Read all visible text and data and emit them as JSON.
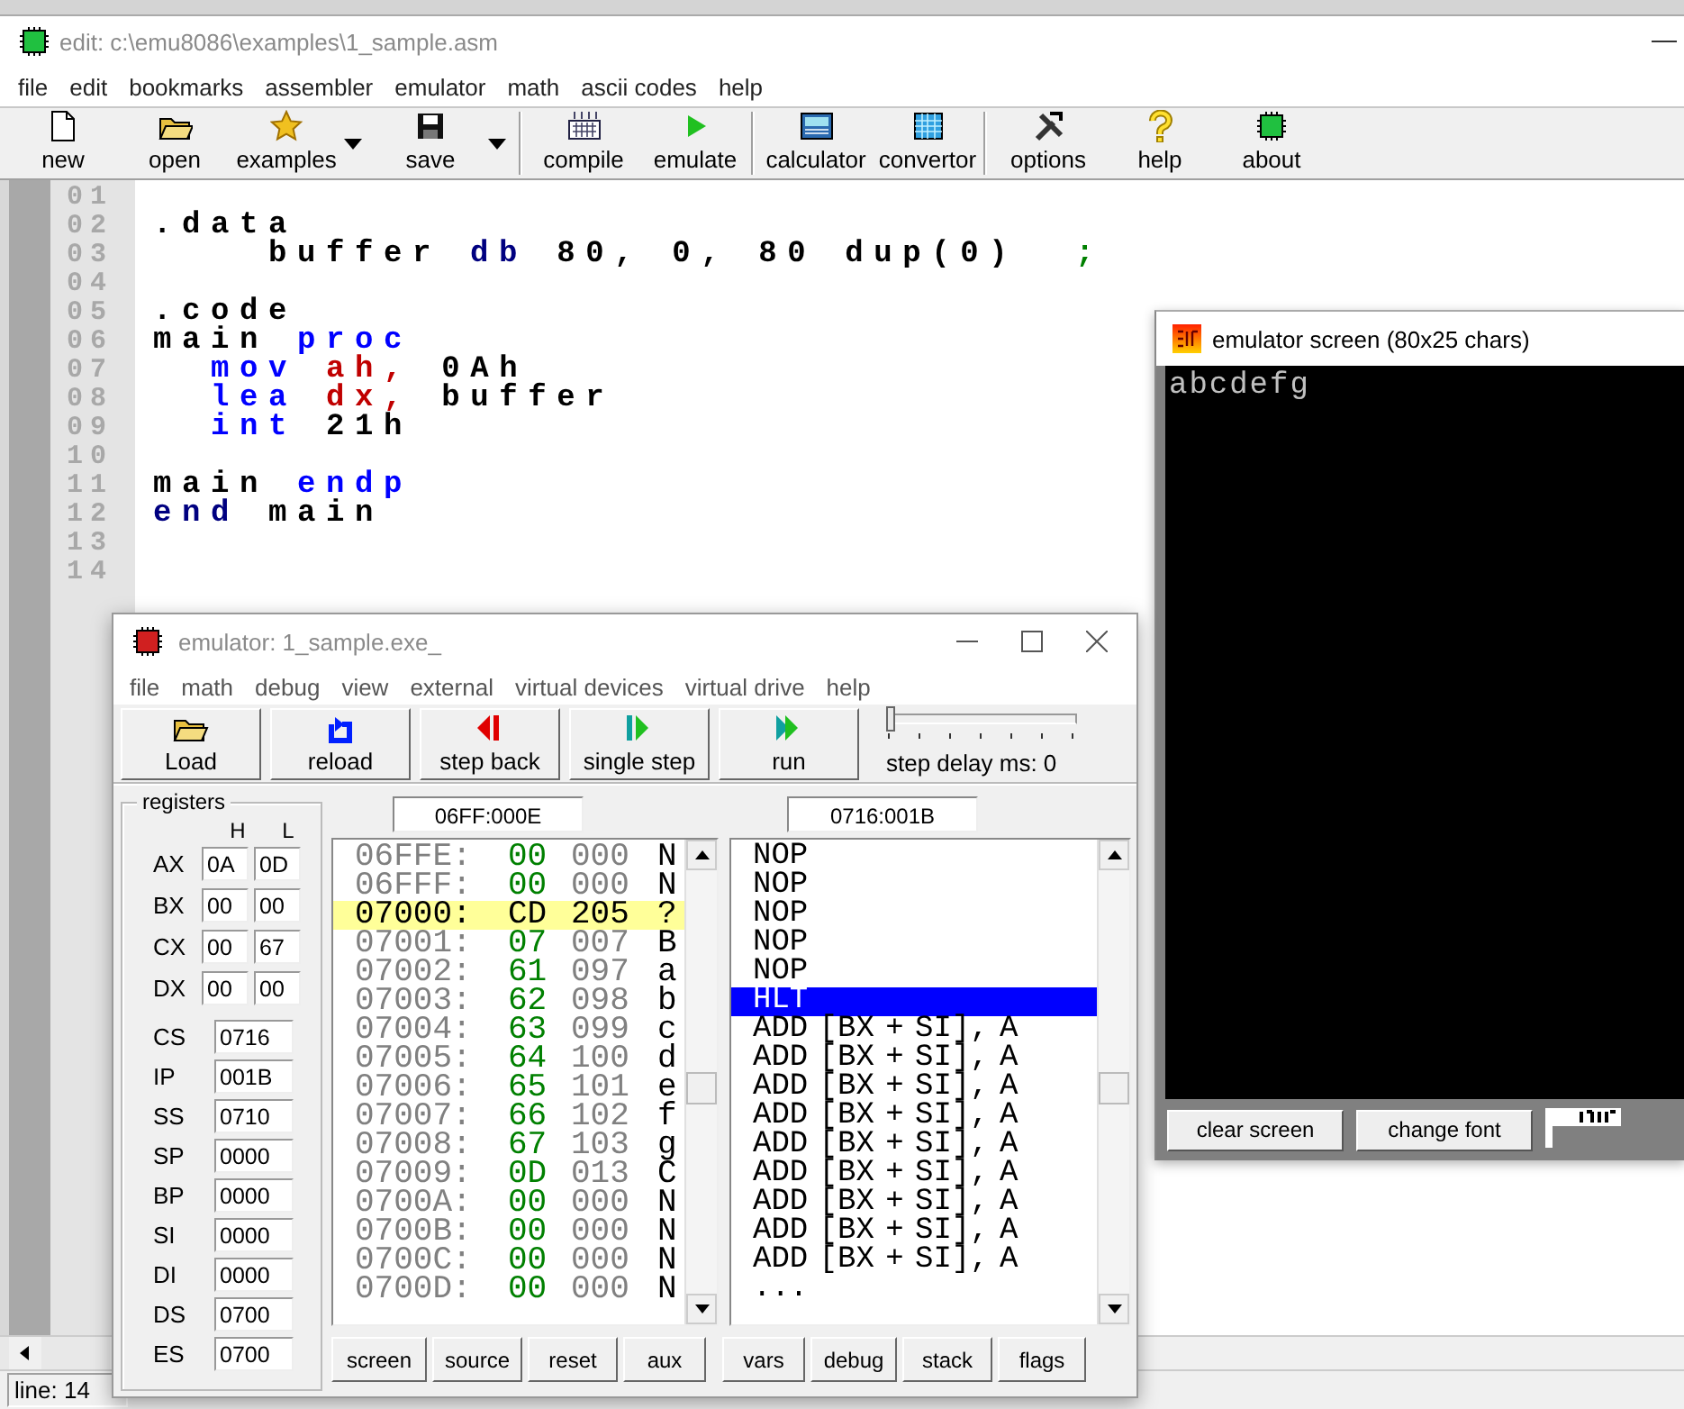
{
  "editor": {
    "title": "edit: c:\\emu8086\\examples\\1_sample.asm",
    "menu": [
      "file",
      "edit",
      "bookmarks",
      "assembler",
      "emulator",
      "math",
      "ascii codes",
      "help"
    ],
    "toolbar_groups": [
      [
        {
          "label": "new",
          "kind": "button"
        },
        {
          "label": "open",
          "kind": "button"
        },
        {
          "label": "examples",
          "kind": "dropdown"
        },
        {
          "label": "save",
          "kind": "dropdown"
        }
      ],
      [
        {
          "label": "compile",
          "kind": "button"
        },
        {
          "label": "emulate",
          "kind": "button"
        }
      ],
      [
        {
          "label": "calculator",
          "kind": "button"
        },
        {
          "label": "convertor",
          "kind": "button"
        }
      ],
      [
        {
          "label": "options",
          "kind": "button"
        },
        {
          "label": "help",
          "kind": "button"
        },
        {
          "label": "about",
          "kind": "button"
        }
      ]
    ],
    "code_lines": [
      {
        "number": "01"
      },
      {
        "number": "02",
        "kind": "top",
        "tokens": [
          {
            "kind": "plain",
            "text": ".data"
          }
        ]
      },
      {
        "number": "03",
        "kind": "data",
        "tokens": [
          {
            "kind": "plain",
            "text": "buffer"
          },
          {
            "kind": "directive",
            "text": "db"
          },
          {
            "kind": "plain",
            "text": "80, 0, 80 dup(0)"
          },
          {
            "kind": "comment",
            "text": ";"
          }
        ]
      },
      {
        "number": "04"
      },
      {
        "number": "05",
        "kind": "top",
        "tokens": [
          {
            "kind": "plain",
            "text": ".code"
          }
        ]
      },
      {
        "number": "06",
        "kind": "top",
        "tokens": [
          {
            "kind": "plain",
            "text": "main"
          },
          {
            "kind": "keyword",
            "text": "proc"
          }
        ]
      },
      {
        "number": "07",
        "kind": "instruction",
        "tokens": [
          {
            "kind": "keyword",
            "text": "mov"
          },
          {
            "kind": "register",
            "text": "ah,"
          },
          {
            "kind": "plain",
            "text": "0Ah"
          }
        ]
      },
      {
        "number": "08",
        "kind": "instruction",
        "tokens": [
          {
            "kind": "keyword",
            "text": "lea"
          },
          {
            "kind": "register",
            "text": "dx,"
          },
          {
            "kind": "plain",
            "text": "buffer"
          }
        ]
      },
      {
        "number": "09",
        "kind": "instruction",
        "tokens": [
          {
            "kind": "keyword",
            "text": "int"
          },
          {
            "kind": "plain",
            "text": "21h"
          }
        ]
      },
      {
        "number": "10"
      },
      {
        "number": "11",
        "kind": "top",
        "tokens": [
          {
            "kind": "plain",
            "text": "main"
          },
          {
            "kind": "keyword",
            "text": "endp"
          }
        ]
      },
      {
        "number": "12",
        "kind": "top",
        "tokens": [
          {
            "kind": "directive",
            "text": "end"
          },
          {
            "kind": "plain",
            "text": "main"
          }
        ]
      },
      {
        "number": "13"
      },
      {
        "number": "14"
      }
    ],
    "status": "line: 14"
  },
  "screen_window": {
    "title": "emulator screen (80x25 chars)",
    "output": "abcdefg",
    "buttons": [
      "clear screen",
      "change font"
    ]
  },
  "emulator": {
    "title": "emulator: 1_sample.exe_",
    "menu": [
      "file",
      "math",
      "debug",
      "view",
      "external",
      "virtual devices",
      "virtual drive",
      "help"
    ],
    "buttons": [
      "Load",
      "reload",
      "step back",
      "single step",
      "run"
    ],
    "step_delay": {
      "label": "step delay ms: 0",
      "level": 0
    },
    "registers": {
      "title": "registers",
      "headers": [
        "H",
        "L"
      ],
      "pairs": [
        {
          "name": "AX",
          "h": "0A",
          "l": "0D"
        },
        {
          "name": "BX",
          "h": "00",
          "l": "00"
        },
        {
          "name": "CX",
          "h": "00",
          "l": "67"
        },
        {
          "name": "DX",
          "h": "00",
          "l": "00"
        }
      ],
      "words": [
        {
          "name": "CS",
          "value": "0716"
        },
        {
          "name": "IP",
          "value": "001B"
        },
        {
          "name": "SS",
          "value": "0710"
        },
        {
          "name": "SP",
          "value": "0000"
        },
        {
          "name": "BP",
          "value": "0000"
        },
        {
          "name": "SI",
          "value": "0000"
        },
        {
          "name": "DI",
          "value": "0000"
        },
        {
          "name": "DS",
          "value": "0700"
        },
        {
          "name": "ES",
          "value": "0700"
        }
      ]
    },
    "memory_address": "06FF:000E",
    "disassembly_address": "0716:001B",
    "memory": [
      {
        "address": "06FFE:",
        "hex": "00",
        "dec": "000",
        "char": "N",
        "selected": false
      },
      {
        "address": "06FFF:",
        "hex": "00",
        "dec": "000",
        "char": "N",
        "selected": false
      },
      {
        "address": "07000:",
        "hex": "CD",
        "dec": "205",
        "char": "?",
        "selected": true
      },
      {
        "address": "07001:",
        "hex": "07",
        "dec": "007",
        "char": "B",
        "selected": false
      },
      {
        "address": "07002:",
        "hex": "61",
        "dec": "097",
        "char": "a",
        "selected": false
      },
      {
        "address": "07003:",
        "hex": "62",
        "dec": "098",
        "char": "b",
        "selected": false
      },
      {
        "address": "07004:",
        "hex": "63",
        "dec": "099",
        "char": "c",
        "selected": false
      },
      {
        "address": "07005:",
        "hex": "64",
        "dec": "100",
        "char": "d",
        "selected": false
      },
      {
        "address": "07006:",
        "hex": "65",
        "dec": "101",
        "char": "e",
        "selected": false
      },
      {
        "address": "07007:",
        "hex": "66",
        "dec": "102",
        "char": "f",
        "selected": false
      },
      {
        "address": "07008:",
        "hex": "67",
        "dec": "103",
        "char": "g",
        "selected": false
      },
      {
        "address": "07009:",
        "hex": "0D",
        "dec": "013",
        "char": "C",
        "selected": false
      },
      {
        "address": "0700A:",
        "hex": "00",
        "dec": "000",
        "char": "N",
        "selected": false
      },
      {
        "address": "0700B:",
        "hex": "00",
        "dec": "000",
        "char": "N",
        "selected": false
      },
      {
        "address": "0700C:",
        "hex": "00",
        "dec": "000",
        "char": "N",
        "selected": false
      },
      {
        "address": "0700D:",
        "hex": "00",
        "dec": "000",
        "char": "N",
        "selected": false
      }
    ],
    "disassembly": [
      {
        "text": "NOP",
        "selected": false
      },
      {
        "text": "NOP",
        "selected": false
      },
      {
        "text": "NOP",
        "selected": false
      },
      {
        "text": "NOP",
        "selected": false
      },
      {
        "text": "NOP",
        "selected": false
      },
      {
        "text": "HLT",
        "selected": true
      },
      {
        "text": "ADD [BX + SI], A",
        "selected": false
      },
      {
        "text": "ADD [BX + SI], A",
        "selected": false
      },
      {
        "text": "ADD [BX + SI], A",
        "selected": false
      },
      {
        "text": "ADD [BX + SI], A",
        "selected": false
      },
      {
        "text": "ADD [BX + SI], A",
        "selected": false
      },
      {
        "text": "ADD [BX + SI], A",
        "selected": false
      },
      {
        "text": "ADD [BX + SI], A",
        "selected": false
      },
      {
        "text": "ADD [BX + SI], A",
        "selected": false
      },
      {
        "text": "ADD [BX + SI], A",
        "selected": false
      },
      {
        "text": "...",
        "selected": false
      }
    ],
    "bottom_buttons": [
      "screen",
      "source",
      "reset",
      "aux",
      "vars",
      "debug",
      "stack",
      "flags"
    ]
  }
}
